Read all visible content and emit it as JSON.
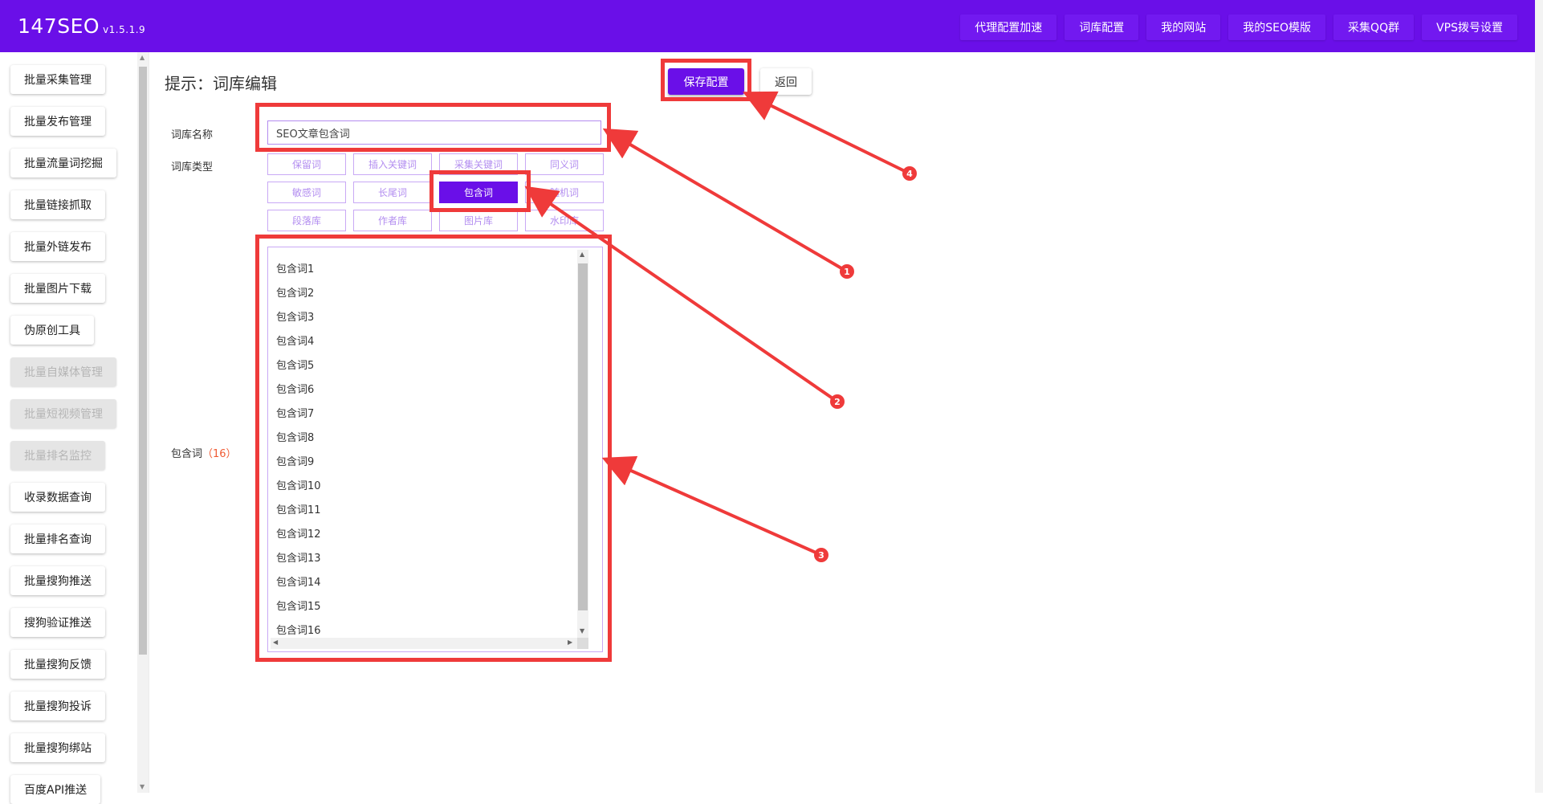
{
  "app": {
    "name": "147SEO",
    "version": "v1.5.1.9"
  },
  "topnav": [
    "代理配置加速",
    "词库配置",
    "我的网站",
    "我的SEO模版",
    "采集QQ群",
    "VPS拨号设置"
  ],
  "sidebar": {
    "items": [
      {
        "label": "批量采集管理",
        "disabled": false
      },
      {
        "label": "批量发布管理",
        "disabled": false
      },
      {
        "label": "批量流量词挖掘",
        "disabled": false
      },
      {
        "label": "批量链接抓取",
        "disabled": false
      },
      {
        "label": "批量外链发布",
        "disabled": false
      },
      {
        "label": "批量图片下载",
        "disabled": false
      },
      {
        "label": "伪原创工具",
        "disabled": false
      },
      {
        "label": "批量自媒体管理",
        "disabled": true
      },
      {
        "label": "批量短视频管理",
        "disabled": true
      },
      {
        "label": "批量排名监控",
        "disabled": true
      },
      {
        "label": "收录数据查询",
        "disabled": false
      },
      {
        "label": "批量排名查询",
        "disabled": false
      },
      {
        "label": "批量搜狗推送",
        "disabled": false
      },
      {
        "label": "搜狗验证推送",
        "disabled": false
      },
      {
        "label": "批量搜狗反馈",
        "disabled": false
      },
      {
        "label": "批量搜狗投诉",
        "disabled": false
      },
      {
        "label": "批量搜狗绑站",
        "disabled": false
      },
      {
        "label": "百度API推送",
        "disabled": false
      }
    ]
  },
  "main": {
    "title": "提示：词库编辑",
    "save_label": "保存配置",
    "back_label": "返回",
    "name_label": "词库名称",
    "name_value": "SEO文章包含词",
    "type_label": "词库类型",
    "types": [
      [
        "保留词",
        "插入关键词",
        "采集关键词",
        "同义词"
      ],
      [
        "敏感词",
        "长尾词",
        "包含词",
        "随机词"
      ],
      [
        "段落库",
        "作者库",
        "图片库",
        "水印库"
      ]
    ],
    "active_type": "包含词",
    "words_label": "包含词",
    "words_count": "（16）",
    "words": [
      "包含词1",
      "包含词2",
      "包含词3",
      "包含词4",
      "包含词5",
      "包含词6",
      "包含词7",
      "包含词8",
      "包含词9",
      "包含词10",
      "包含词11",
      "包含词12",
      "包含词13",
      "包含词14",
      "包含词15",
      "包含词16"
    ]
  },
  "annotations": {
    "markers": [
      "1",
      "2",
      "3",
      "4"
    ],
    "color": "#ef3a3a"
  },
  "colors": {
    "brand": "#6a0fe8",
    "accent_border": "#c9a9f5"
  }
}
